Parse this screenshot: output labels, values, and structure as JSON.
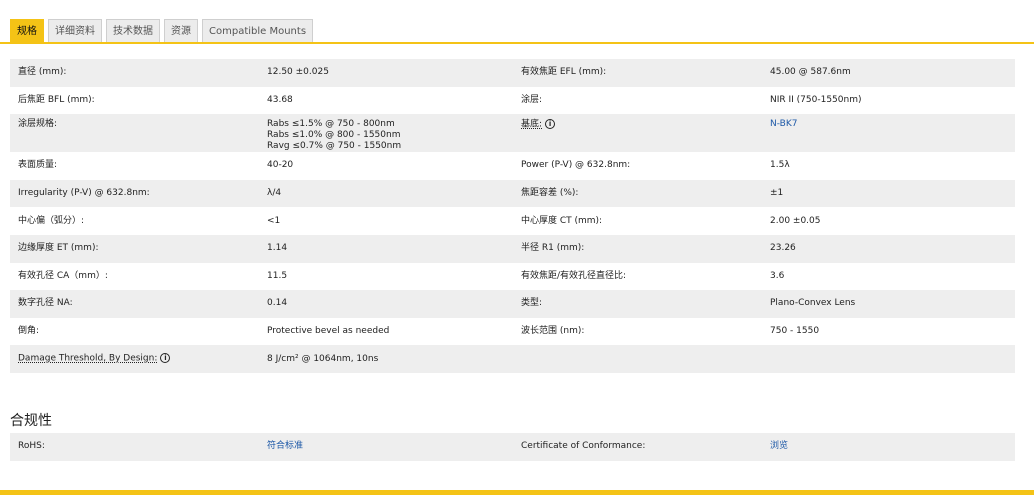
{
  "tabs": [
    {
      "label": "规格",
      "active": true
    },
    {
      "label": "详细资料",
      "active": false
    },
    {
      "label": "技术数据",
      "active": false
    },
    {
      "label": "资源",
      "active": false
    },
    {
      "label": "Compatible Mounts",
      "active": false
    }
  ],
  "specs": {
    "r0": {
      "l1": "直径 (mm):",
      "v1": "12.50 ±0.025",
      "l2": "有效焦距 EFL (mm):",
      "v2": "45.00 @ 587.6nm"
    },
    "r1": {
      "l1": "后焦距 BFL (mm):",
      "v1": "43.68",
      "l2": "涂层:",
      "v2": "NIR II (750-1550nm)"
    },
    "r2": {
      "l1": "涂层规格:",
      "v1a": "Rabs ≤1.5% @ 750 - 800nm",
      "v1b": "Rabs ≤1.0% @ 800 - 1550nm",
      "v1c": "Ravg ≤0.7% @ 750 - 1550nm",
      "l2": "基底:",
      "v2": "N-BK7"
    },
    "r3": {
      "l1": "表面质量:",
      "v1": "40-20",
      "l2": "Power (P-V) @ 632.8nm:",
      "v2": "1.5λ"
    },
    "r4": {
      "l1": "Irregularity (P-V) @ 632.8nm:",
      "v1": "λ/4",
      "l2": "焦距容差 (%):",
      "v2": "±1"
    },
    "r5": {
      "l1": "中心偏（弧分）:",
      "v1": "<1",
      "l2": "中心厚度 CT (mm):",
      "v2": "2.00 ±0.05"
    },
    "r6": {
      "l1": "边缘厚度 ET (mm):",
      "v1": "1.14",
      "l2": "半径 R1 (mm):",
      "v2": "23.26"
    },
    "r7": {
      "l1": "有效孔径 CA（mm）:",
      "v1": "11.5",
      "l2": "有效焦距/有效孔径直径比:",
      "v2": "3.6"
    },
    "r8": {
      "l1": "数字孔径 NA:",
      "v1": "0.14",
      "l2": "类型:",
      "v2": "Plano-Convex Lens"
    },
    "r9": {
      "l1": "倒角:",
      "v1": "Protective bevel as needed",
      "l2": "波长范围 (nm):",
      "v2": "750 - 1550"
    },
    "r10": {
      "l1": "Damage Threshold, By Design:",
      "v1": "8 J/cm² @ 1064nm, 10ns"
    }
  },
  "compliance": {
    "title": "合规性",
    "rohs_label": "RoHS:",
    "rohs_value": "符合标准",
    "coc_label": "Certificate of Conformance:",
    "coc_value": "浏览"
  },
  "icons": {
    "info": "i",
    "accent_color": "#f4c316"
  }
}
